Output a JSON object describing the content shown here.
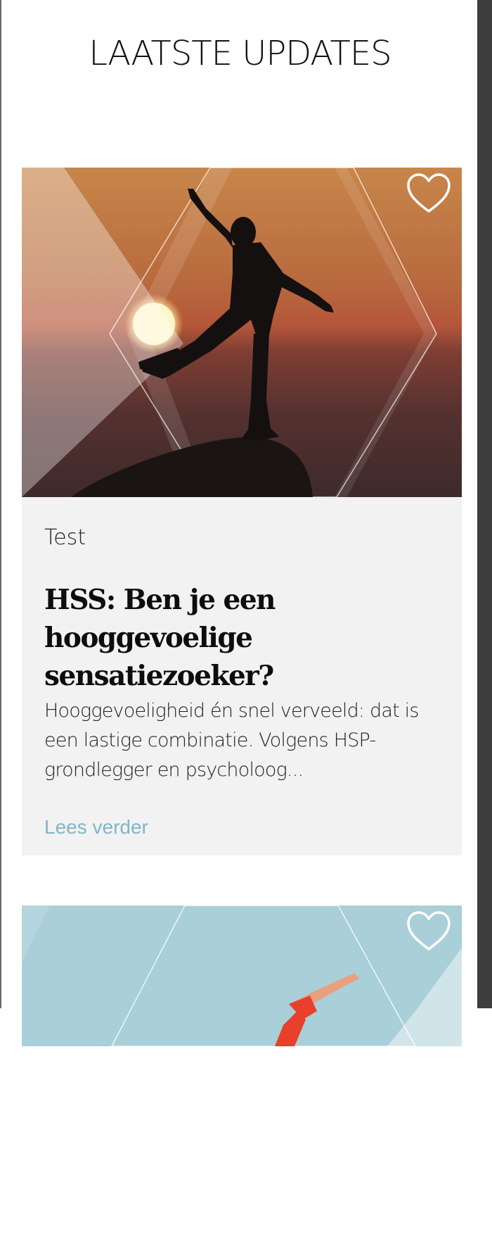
{
  "section": {
    "title": "LAATSTE UPDATES"
  },
  "cards": [
    {
      "category": "Test",
      "title": "HSS: Ben je een hooggevoelige sensatiezoeker?",
      "excerpt": "Hooggevoeligheid én snel verveeld: dat is een lastige combinatie. Volgens HSP-grondlegger en psycholoog...",
      "read_more": "Lees verder",
      "favorite_icon": "heart-outline-icon",
      "image": "silhouette-balancing-on-rock-at-sunset"
    },
    {
      "favorite_icon": "heart-outline-icon",
      "image": "swimmer-diving-over-water"
    }
  ],
  "colors": {
    "link": "#7fb6c8",
    "card_background": "#f2f2f2",
    "title": "#0d0d0d"
  }
}
